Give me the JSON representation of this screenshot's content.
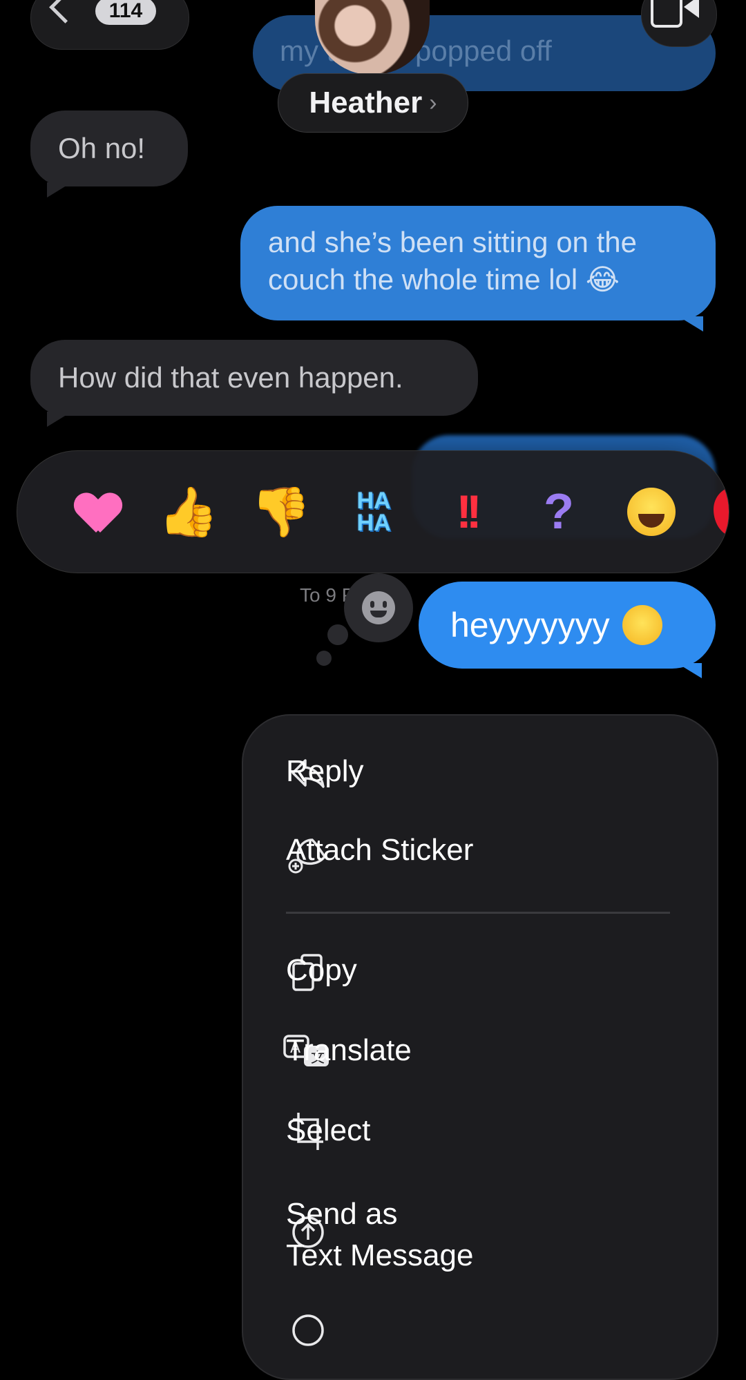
{
  "header": {
    "back_count": "114",
    "contact_name": "Heather",
    "contact_chevron": "›",
    "faded_message": "my      thumb popped off"
  },
  "messages": [
    {
      "from": "them",
      "text": "Oh no!"
    },
    {
      "from": "me",
      "text": "and she’s been sitting on the couch the whole time lol 😂"
    },
    {
      "from": "them",
      "text": "How did that even happen."
    },
    {
      "from": "me",
      "text": "heyyyyyyy"
    }
  ],
  "tapbacks": [
    {
      "name": "heart",
      "icon": "heart-icon"
    },
    {
      "name": "thumbs-up",
      "icon": "thumbs-up-icon",
      "glyph": "👍"
    },
    {
      "name": "thumbs-down",
      "icon": "thumbs-down-icon",
      "glyph": "👎"
    },
    {
      "name": "haha",
      "label": "HA\nHA"
    },
    {
      "name": "emphasize",
      "label": "!!"
    },
    {
      "name": "question",
      "label": "?"
    },
    {
      "name": "laugh-emoji",
      "icon": "laughing-emoji-icon"
    },
    {
      "name": "balloon",
      "icon": "balloon-icon"
    }
  ],
  "timestamp": "To        9 PM",
  "menu": {
    "items": [
      {
        "label": "Reply",
        "icon": "reply-icon"
      },
      {
        "label": "Attach Sticker",
        "icon": "sticker-icon"
      },
      {
        "label": "Copy",
        "icon": "copy-icon"
      },
      {
        "label": "Translate",
        "icon": "translate-icon"
      },
      {
        "label": "Select",
        "icon": "crop-select-icon"
      },
      {
        "label": "Send as\nText Message",
        "icon": "arrow-up-circle-icon"
      }
    ]
  },
  "colors": {
    "background": "#000000",
    "sent_bubble": "#2E8CF0",
    "received_bubble": "#26262A",
    "menu_bg": "#1C1C1F"
  }
}
